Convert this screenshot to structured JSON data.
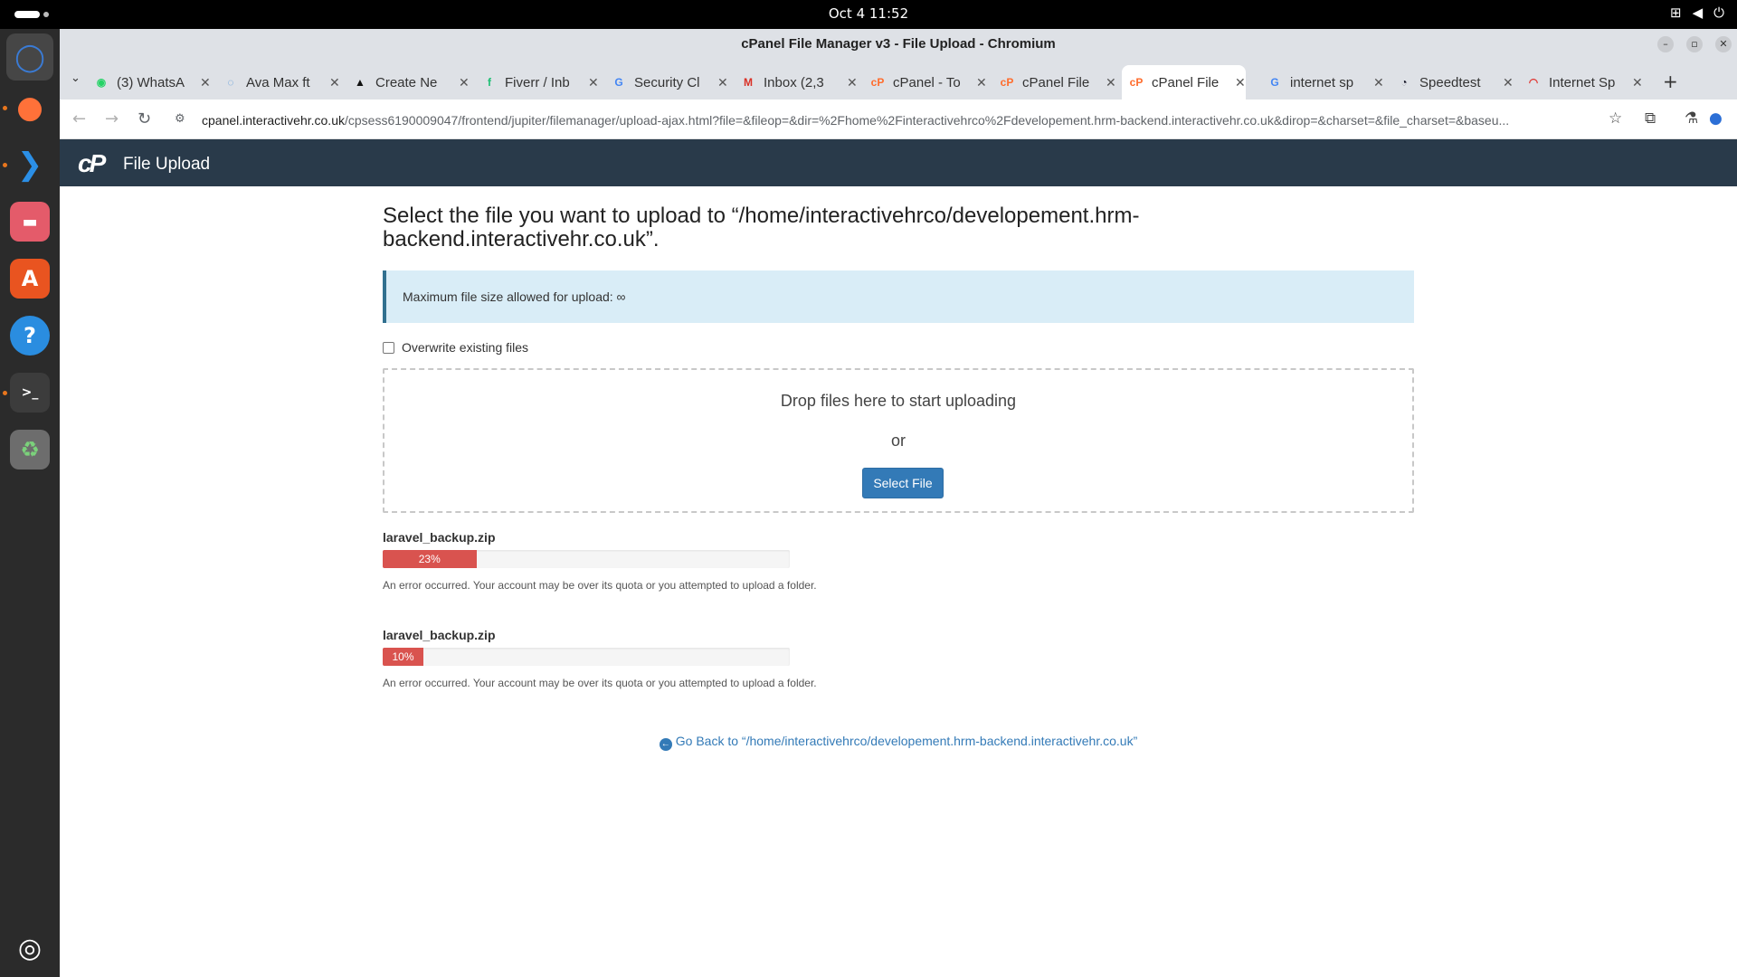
{
  "system": {
    "clock": "Oct 4  11:52"
  },
  "dock": {
    "apps": [
      {
        "icon": "chromium-icon",
        "glyph": "◯",
        "color": "#3a7bd5"
      },
      {
        "icon": "firefox-icon",
        "glyph": "●",
        "color": "#ff7139"
      },
      {
        "icon": "vscode-icon",
        "glyph": "❯",
        "color": "#2b8fe6"
      },
      {
        "icon": "files-icon",
        "glyph": "▬",
        "color": "#e45b6a"
      },
      {
        "icon": "app-center-icon",
        "glyph": "A",
        "color": "#e95420"
      },
      {
        "icon": "help-icon",
        "glyph": "?",
        "color": "#2a8de0"
      },
      {
        "icon": "terminal-icon",
        "glyph": ">_",
        "color": "#3c3c3c"
      },
      {
        "icon": "trash-icon",
        "glyph": "♻",
        "color": "#6b8f6b"
      }
    ]
  },
  "browser": {
    "window_title": "cPanel File Manager v3 - File Upload - Chromium",
    "tabs": [
      {
        "label": "(3) WhatsA",
        "favicon": "whatsapp-icon",
        "color": "#25d366",
        "glyph": "◉"
      },
      {
        "label": "Ava Max ft",
        "favicon": "loading-icon",
        "color": "#4a90d9",
        "glyph": "◌"
      },
      {
        "label": "Create Ne",
        "favicon": "create-icon",
        "color": "#111111",
        "glyph": "▲"
      },
      {
        "label": "Fiverr / Inb",
        "favicon": "fiverr-icon",
        "color": "#1dbf73",
        "glyph": "f"
      },
      {
        "label": "Security Cl",
        "favicon": "google-icon",
        "color": "#4285f4",
        "glyph": "G"
      },
      {
        "label": "Inbox (2,3",
        "favicon": "gmail-icon",
        "color": "#d93025",
        "glyph": "M"
      },
      {
        "label": "cPanel - To",
        "favicon": "cpanel-icon",
        "color": "#ff6c2c",
        "glyph": "cP"
      },
      {
        "label": "cPanel File",
        "favicon": "cpanel-icon",
        "color": "#ff6c2c",
        "glyph": "cP"
      },
      {
        "label": "cPanel File",
        "favicon": "cpanel-icon",
        "color": "#ff6c2c",
        "glyph": "cP",
        "active": true
      },
      {
        "label": "internet sp",
        "favicon": "google-icon",
        "color": "#4285f4",
        "glyph": "G"
      },
      {
        "label": "Speedtest",
        "favicon": "speedtest-icon",
        "color": "#141526",
        "glyph": "◔"
      },
      {
        "label": "Internet Sp",
        "favicon": "speed-icon",
        "color": "#e0342f",
        "glyph": "◠"
      }
    ],
    "url_host": "cpanel.interactivehr.co.uk",
    "url_path": "/cpsess6190009047/frontend/jupiter/filemanager/upload-ajax.html?file=&fileop=&dir=%2Fhome%2Finteractivehrco%2Fdevelopement.hrm-backend.interactivehr.co.uk&dirop=&charset=&file_charset=&baseu..."
  },
  "cpanel": {
    "logo_text": "cP",
    "header_title": "File Upload",
    "heading": "Select the file you want to upload to “/home/interactivehrco/developement.hrm-backend.interactivehr.co.uk”.",
    "max_size_notice": "Maximum file size allowed for upload: ∞",
    "overwrite_label": "Overwrite existing files",
    "drop_text": "Drop files here to start uploading",
    "or_text": "or",
    "select_file_label": "Select File",
    "uploads": [
      {
        "filename": "laravel_backup.zip",
        "progress": 0.23,
        "progress_label": "23%",
        "error": "An error occurred. Your account may be over its quota or you attempted to upload a folder."
      },
      {
        "filename": "laravel_backup.zip",
        "progress": 0.1,
        "progress_label": "10%",
        "error": "An error occurred. Your account may be over its quota or you attempted to upload a folder."
      }
    ],
    "go_back_label": "Go Back to “/home/interactivehrco/developement.hrm-backend.interactivehr.co.uk”"
  }
}
